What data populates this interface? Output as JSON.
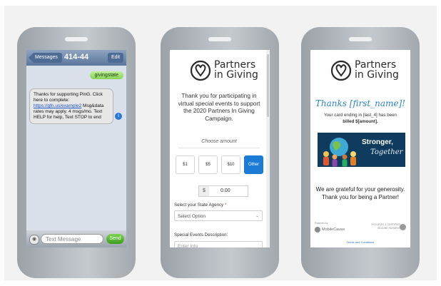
{
  "sms": {
    "back_label": "Messages",
    "title": "414-44",
    "edit_label": "Edit",
    "outgoing": "givingstate",
    "incoming_part1": "Thanks for supporting PinG. Click here to complete:",
    "incoming_link": "https://gfn.us/example2",
    "incoming_part2": "Msg&data rates may apply. 4 msgs/mo. Text HELP for help, Text STOP to end",
    "input_placeholder": "Text Message",
    "send_label": "Send",
    "info_icon": "i"
  },
  "logo": {
    "line1": "Partners",
    "line2": "in Giving"
  },
  "form": {
    "intro": "Thank you for participating in virtual special events to support the 2020 Partners In Giving Campaign.",
    "choose_amount": "Choose amount",
    "amounts": [
      "$1",
      "$5",
      "$10",
      "Other"
    ],
    "currency": "$",
    "amount_value": "0.00",
    "state_label": "Select your State Agency",
    "required_mark": "*",
    "state_placeholder": "Select Option",
    "events_label": "Special Events Description:",
    "events_placeholder": "Enter Info"
  },
  "receipt": {
    "thanks": "Thanks [first_name]!",
    "billed_line1": "Your card ending in [last_4] has been",
    "billed_line2": "billed $[amount].",
    "banner_line1": "Stronger,",
    "banner_line2": "Together",
    "grateful": "We are grateful for your generosity. Thank you for being a Partner!",
    "powered_by": "Powered by",
    "mobilecause": "MobileCause",
    "secure_line1": "PCI LEVEL 1 CERTIFIED",
    "secure_line2": "SECURE PAYMENT",
    "terms": "Terms and Conditions"
  },
  "colors": {
    "accent": "#1b7bd6",
    "thanks_blue": "#2b83c6",
    "sms_green": "#86d255"
  }
}
